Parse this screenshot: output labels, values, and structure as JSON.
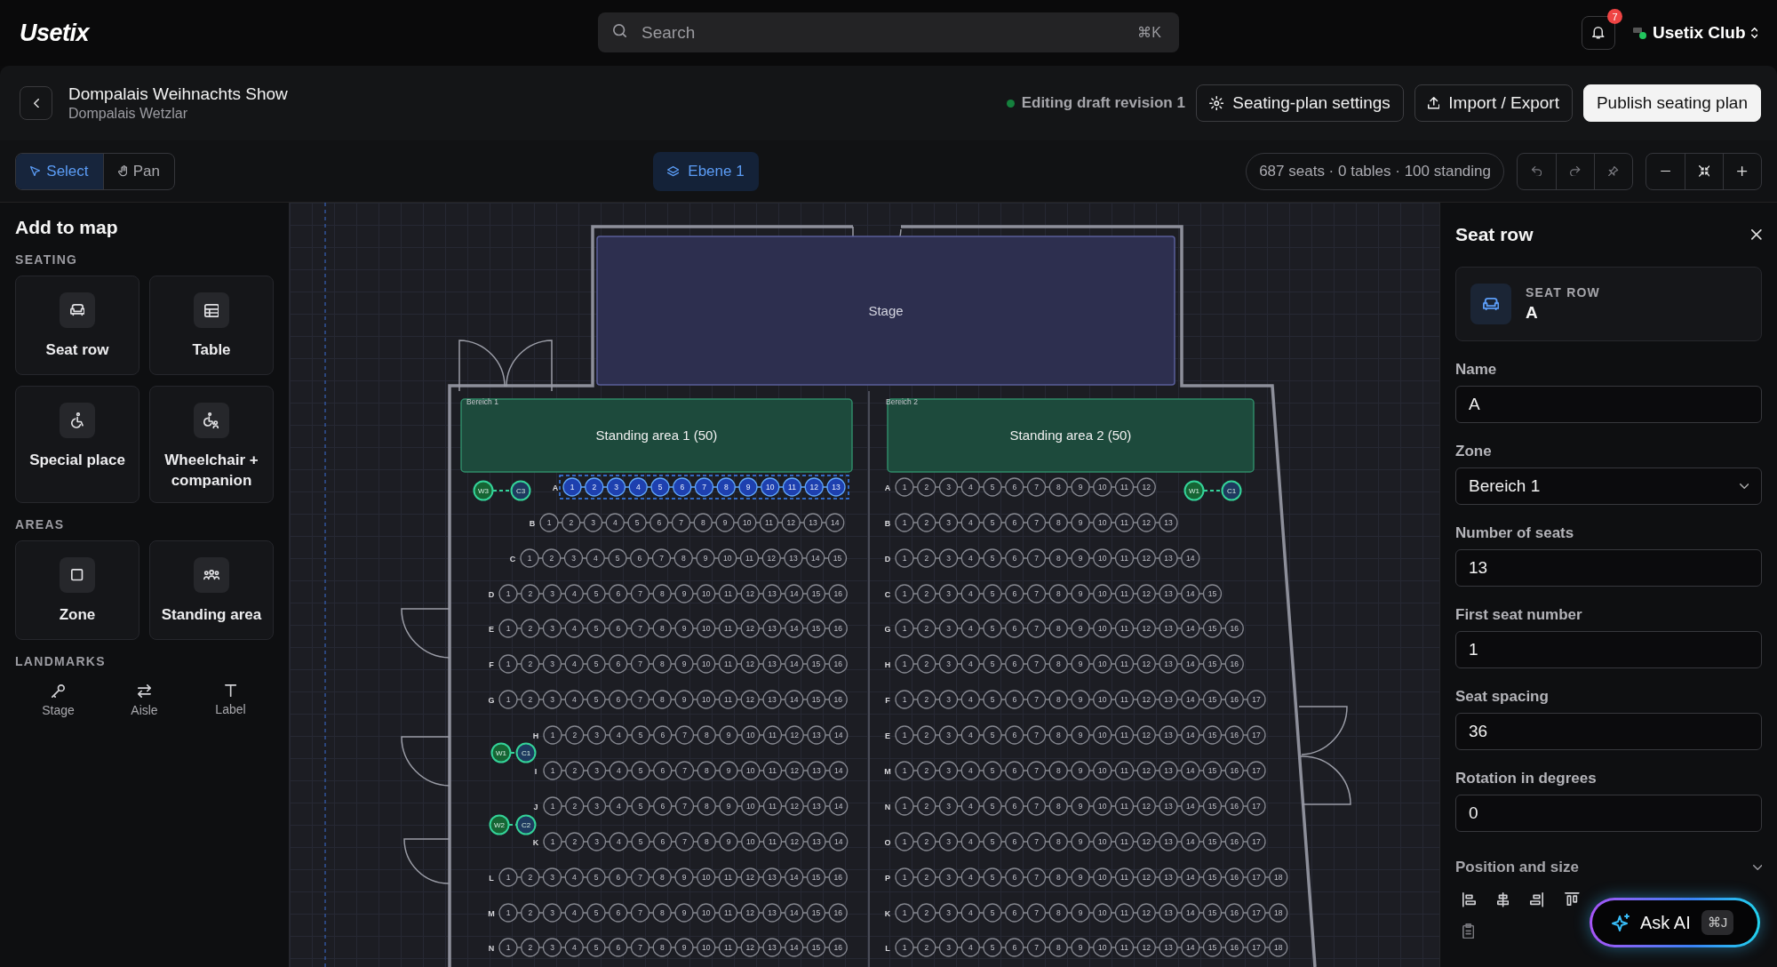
{
  "app": {
    "logo": "Usetix",
    "search": {
      "placeholder": "Search",
      "shortcut": "⌘K"
    },
    "notifications": {
      "count": "7"
    },
    "org": {
      "name": "Usetix Club"
    }
  },
  "header": {
    "title": "Dompalais Weihnachts Show",
    "subtitle": "Dompalais Wetzlar",
    "status": "Editing draft revision 1",
    "buttons": [
      {
        "label": "Seating-plan settings",
        "kind": "settings"
      },
      {
        "label": "Import / Export",
        "kind": "export"
      },
      {
        "label": "Publish seating plan",
        "kind": "primary"
      }
    ]
  },
  "toolbar": {
    "tools": [
      {
        "label": "Select",
        "kind": "select",
        "selected": true
      },
      {
        "label": "Pan",
        "kind": "pan",
        "selected": false
      }
    ],
    "layer": "Ebene 1",
    "summary": "687 seats · 0 tables · 100 standing"
  },
  "sidebar": {
    "title": "Add to map",
    "sections": [
      {
        "heading": "SEATING",
        "kind": "cards",
        "items": [
          {
            "label": "Seat row",
            "kind": "seat-row"
          },
          {
            "label": "Table",
            "kind": "table"
          },
          {
            "label": "Special place",
            "kind": "special"
          },
          {
            "label": "Wheelchair + companion",
            "kind": "wheelchair"
          }
        ]
      },
      {
        "heading": "AREAS",
        "kind": "cards",
        "items": [
          {
            "label": "Zone",
            "kind": "zone"
          },
          {
            "label": "Standing area",
            "kind": "standing"
          }
        ]
      },
      {
        "heading": "LANDMARKS",
        "kind": "compact",
        "items": [
          {
            "label": "Stage",
            "kind": "stage"
          },
          {
            "label": "Aisle",
            "kind": "aisle"
          },
          {
            "label": "Label",
            "kind": "label"
          }
        ]
      }
    ]
  },
  "map": {
    "stage": {
      "label": "Stage"
    },
    "blocks": [
      {
        "zone": "Bereich 1",
        "standing_area": "Standing area 1 (50)",
        "rows": [
          {
            "label": "A",
            "selected": true,
            "seats": [
              "1",
              "2",
              "3",
              "4",
              "5",
              "6",
              "7",
              "8",
              "9",
              "10",
              "11",
              "12",
              "13"
            ]
          },
          {
            "label": "B",
            "selected": false,
            "seats": [
              "1",
              "2",
              "3",
              "4",
              "5",
              "6",
              "7",
              "8",
              "9",
              "10",
              "11",
              "12",
              "13",
              "14"
            ]
          },
          {
            "label": "C",
            "selected": false,
            "seats": [
              "1",
              "2",
              "3",
              "4",
              "5",
              "6",
              "7",
              "8",
              "9",
              "10",
              "11",
              "12",
              "13",
              "14",
              "15"
            ]
          },
          {
            "label": "D",
            "selected": false,
            "seats": [
              "1",
              "2",
              "3",
              "4",
              "5",
              "6",
              "7",
              "8",
              "9",
              "10",
              "11",
              "12",
              "13",
              "14",
              "15",
              "16"
            ]
          },
          {
            "label": "E",
            "selected": false,
            "seats": [
              "1",
              "2",
              "3",
              "4",
              "5",
              "6",
              "7",
              "8",
              "9",
              "10",
              "11",
              "12",
              "13",
              "14",
              "15",
              "16"
            ]
          },
          {
            "label": "F",
            "selected": false,
            "seats": [
              "1",
              "2",
              "3",
              "4",
              "5",
              "6",
              "7",
              "8",
              "9",
              "10",
              "11",
              "12",
              "13",
              "14",
              "15",
              "16"
            ]
          },
          {
            "label": "G",
            "selected": false,
            "seats": [
              "1",
              "2",
              "3",
              "4",
              "5",
              "6",
              "7",
              "8",
              "9",
              "10",
              "11",
              "12",
              "13",
              "14",
              "15",
              "16"
            ]
          },
          {
            "label": "H",
            "selected": false,
            "seats": [
              "1",
              "2",
              "3",
              "4",
              "5",
              "6",
              "7",
              "8",
              "9",
              "10",
              "11",
              "12",
              "13",
              "14"
            ]
          },
          {
            "label": "I",
            "selected": false,
            "seats": [
              "1",
              "2",
              "3",
              "4",
              "5",
              "6",
              "7",
              "8",
              "9",
              "10",
              "11",
              "12",
              "13",
              "14"
            ]
          },
          {
            "label": "J",
            "selected": false,
            "seats": [
              "1",
              "2",
              "3",
              "4",
              "5",
              "6",
              "7",
              "8",
              "9",
              "10",
              "11",
              "12",
              "13",
              "14"
            ]
          },
          {
            "label": "K",
            "selected": false,
            "seats": [
              "1",
              "2",
              "3",
              "4",
              "5",
              "6",
              "7",
              "8",
              "9",
              "10",
              "11",
              "12",
              "13",
              "14"
            ]
          },
          {
            "label": "L",
            "selected": false,
            "seats": [
              "1",
              "2",
              "3",
              "4",
              "5",
              "6",
              "7",
              "8",
              "9",
              "10",
              "11",
              "12",
              "13",
              "14",
              "15",
              "16"
            ]
          },
          {
            "label": "M",
            "selected": false,
            "seats": [
              "1",
              "2",
              "3",
              "4",
              "5",
              "6",
              "7",
              "8",
              "9",
              "10",
              "11",
              "12",
              "13",
              "14",
              "15",
              "16"
            ]
          },
          {
            "label": "N",
            "selected": false,
            "seats": [
              "1",
              "2",
              "3",
              "4",
              "5",
              "6",
              "7",
              "8",
              "9",
              "10",
              "11",
              "12",
              "13",
              "14",
              "15",
              "16"
            ]
          }
        ],
        "companion_pairs": [
          {
            "wheelchair": "W3",
            "companion": "C3"
          },
          {
            "wheelchair": "W1",
            "companion": "C1"
          },
          {
            "wheelchair": "W2",
            "companion": "C2"
          }
        ]
      },
      {
        "zone": "Bereich 2",
        "standing_area": "Standing area 2 (50)",
        "rows": [
          {
            "label": "A",
            "selected": false,
            "seats": [
              "1",
              "2",
              "3",
              "4",
              "5",
              "6",
              "7",
              "8",
              "9",
              "10",
              "11",
              "12"
            ]
          },
          {
            "label": "B",
            "selected": false,
            "seats": [
              "1",
              "2",
              "3",
              "4",
              "5",
              "6",
              "7",
              "8",
              "9",
              "10",
              "11",
              "12",
              "13"
            ]
          },
          {
            "label": "D",
            "selected": false,
            "seats": [
              "1",
              "2",
              "3",
              "4",
              "5",
              "6",
              "7",
              "8",
              "9",
              "10",
              "11",
              "12",
              "13",
              "14"
            ]
          },
          {
            "label": "C",
            "selected": false,
            "seats": [
              "1",
              "2",
              "3",
              "4",
              "5",
              "6",
              "7",
              "8",
              "9",
              "10",
              "11",
              "12",
              "13",
              "14",
              "15"
            ]
          },
          {
            "label": "G",
            "selected": false,
            "seats": [
              "1",
              "2",
              "3",
              "4",
              "5",
              "6",
              "7",
              "8",
              "9",
              "10",
              "11",
              "12",
              "13",
              "14",
              "15",
              "16"
            ]
          },
          {
            "label": "H",
            "selected": false,
            "seats": [
              "1",
              "2",
              "3",
              "4",
              "5",
              "6",
              "7",
              "8",
              "9",
              "10",
              "11",
              "12",
              "13",
              "14",
              "15",
              "16"
            ]
          },
          {
            "label": "F",
            "selected": false,
            "seats": [
              "1",
              "2",
              "3",
              "4",
              "5",
              "6",
              "7",
              "8",
              "9",
              "10",
              "11",
              "12",
              "13",
              "14",
              "15",
              "16",
              "17"
            ]
          },
          {
            "label": "E",
            "selected": false,
            "seats": [
              "1",
              "2",
              "3",
              "4",
              "5",
              "6",
              "7",
              "8",
              "9",
              "10",
              "11",
              "12",
              "13",
              "14",
              "15",
              "16",
              "17"
            ]
          },
          {
            "label": "M",
            "selected": false,
            "seats": [
              "1",
              "2",
              "3",
              "4",
              "5",
              "6",
              "7",
              "8",
              "9",
              "10",
              "11",
              "12",
              "13",
              "14",
              "15",
              "16",
              "17"
            ]
          },
          {
            "label": "N",
            "selected": false,
            "seats": [
              "1",
              "2",
              "3",
              "4",
              "5",
              "6",
              "7",
              "8",
              "9",
              "10",
              "11",
              "12",
              "13",
              "14",
              "15",
              "16",
              "17"
            ]
          },
          {
            "label": "O",
            "selected": false,
            "seats": [
              "1",
              "2",
              "3",
              "4",
              "5",
              "6",
              "7",
              "8",
              "9",
              "10",
              "11",
              "12",
              "13",
              "14",
              "15",
              "16",
              "17"
            ]
          },
          {
            "label": "P",
            "selected": false,
            "seats": [
              "1",
              "2",
              "3",
              "4",
              "5",
              "6",
              "7",
              "8",
              "9",
              "10",
              "11",
              "12",
              "13",
              "14",
              "15",
              "16",
              "17",
              "18"
            ]
          },
          {
            "label": "K",
            "selected": false,
            "seats": [
              "1",
              "2",
              "3",
              "4",
              "5",
              "6",
              "7",
              "8",
              "9",
              "10",
              "11",
              "12",
              "13",
              "14",
              "15",
              "16",
              "17",
              "18"
            ]
          },
          {
            "label": "L",
            "selected": false,
            "seats": [
              "1",
              "2",
              "3",
              "4",
              "5",
              "6",
              "7",
              "8",
              "9",
              "10",
              "11",
              "12",
              "13",
              "14",
              "15",
              "16",
              "17",
              "18"
            ]
          }
        ],
        "companion_pairs": [
          {
            "wheelchair": "W1",
            "companion": "C1"
          }
        ]
      }
    ]
  },
  "panel": {
    "title": "Seat row",
    "summary": {
      "caption": "SEAT ROW",
      "value": "A"
    },
    "fields": [
      {
        "label": "Name",
        "value": "A",
        "kind": "text"
      },
      {
        "label": "Zone",
        "value": "Bereich 1",
        "kind": "select"
      },
      {
        "label": "Number of seats",
        "value": "13",
        "kind": "text"
      },
      {
        "label": "First seat number",
        "value": "1",
        "kind": "text"
      },
      {
        "label": "Seat spacing",
        "value": "36",
        "kind": "text"
      },
      {
        "label": "Rotation in degrees",
        "value": "0",
        "kind": "text"
      }
    ],
    "section": {
      "label": "Position and size"
    }
  },
  "ask_ai": {
    "label": "Ask AI",
    "shortcut": "⌘J"
  }
}
